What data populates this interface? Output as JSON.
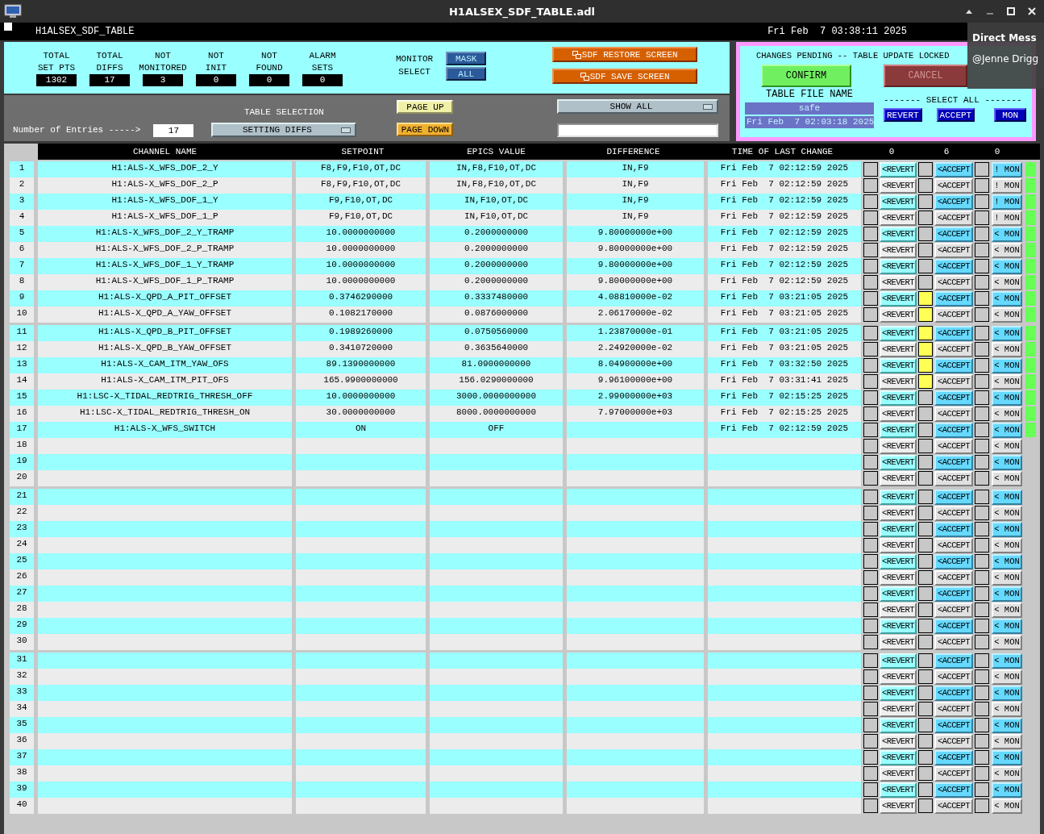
{
  "window": {
    "title": "H1ALSEX_SDF_TABLE.adl"
  },
  "header": {
    "name": "H1ALSEX_SDF_TABLE",
    "datetime": "Fri Feb  7 03:38:11 2025"
  },
  "stats": [
    {
      "label": "TOTAL\nSET PTS",
      "value": "1302"
    },
    {
      "label": "TOTAL\nDIFFS",
      "value": "17"
    },
    {
      "label": "NOT\nMONITORED",
      "value": "3"
    },
    {
      "label": "NOT\nINIT",
      "value": "0"
    },
    {
      "label": "NOT\nFOUND",
      "value": "0"
    },
    {
      "label": "ALARM\nSETS",
      "value": "0"
    }
  ],
  "monitor_select": {
    "label": "MONITOR\nSELECT",
    "buttons": [
      "MASK",
      "ALL"
    ]
  },
  "sdf_buttons": [
    "SDF RESTORE SCREEN",
    "SDF SAVE SCREEN"
  ],
  "table_selection": {
    "label": "TABLE SELECTION",
    "entries_label": "Number of Entries ----->",
    "entries": "17",
    "dropdown": "SETTING DIFFS",
    "page_up": "PAGE UP",
    "page_down": "PAGE DOWN",
    "show_dropdown": "SHOW ALL"
  },
  "pending": {
    "message": "CHANGES PENDING -- TABLE UPDATE LOCKED",
    "confirm": "CONFIRM",
    "cancel": "CANCEL",
    "file_label": "TABLE FILE NAME",
    "file_name": "safe",
    "file_time": "Fri Feb  7 02:03:18 2025",
    "select_all": "------- SELECT ALL -------",
    "select_buttons": [
      "REVERT",
      "ACCEPT",
      "MON"
    ]
  },
  "notification": {
    "title": "Direct Mess",
    "sender": "@Jenne Drigg"
  },
  "table": {
    "columns": [
      "CHANNEL NAME",
      "SETPOINT",
      "EPICS VALUE",
      "DIFFERENCE",
      "TIME OF LAST CHANGE"
    ],
    "counts": [
      "0",
      "6",
      "0"
    ],
    "rows": [
      {
        "n": "1",
        "channel": "H1:ALS-X_WFS_DOF_2_Y",
        "setpoint": "F8,F9,F10,OT,DC",
        "epics": "IN,F8,F10,OT,DC",
        "diff": "IN,F9",
        "time": "Fri Feb  7 02:12:59 2025",
        "revert": "<REVERT",
        "accept": "<ACCEPT",
        "mon": "! MON",
        "revert_selected": false,
        "accept_selected": false,
        "mon_selected": false,
        "in_sync": true
      },
      {
        "n": "2",
        "channel": "H1:ALS-X_WFS_DOF_2_P",
        "setpoint": "F8,F9,F10,OT,DC",
        "epics": "IN,F8,F10,OT,DC",
        "diff": "IN,F9",
        "time": "Fri Feb  7 02:12:59 2025",
        "revert": "<REVERT",
        "accept": "<ACCEPT",
        "mon": "! MON",
        "revert_selected": false,
        "accept_selected": false,
        "mon_selected": false,
        "in_sync": true
      },
      {
        "n": "3",
        "channel": "H1:ALS-X_WFS_DOF_1_Y",
        "setpoint": "F9,F10,OT,DC",
        "epics": "IN,F10,OT,DC",
        "diff": "IN,F9",
        "time": "Fri Feb  7 02:12:59 2025",
        "revert": "<REVERT",
        "accept": "<ACCEPT",
        "mon": "! MON",
        "revert_selected": false,
        "accept_selected": false,
        "mon_selected": false,
        "in_sync": true
      },
      {
        "n": "4",
        "channel": "H1:ALS-X_WFS_DOF_1_P",
        "setpoint": "F9,F10,OT,DC",
        "epics": "IN,F10,OT,DC",
        "diff": "IN,F9",
        "time": "Fri Feb  7 02:12:59 2025",
        "revert": "<REVERT",
        "accept": "<ACCEPT",
        "mon": "! MON",
        "revert_selected": false,
        "accept_selected": false,
        "mon_selected": false,
        "in_sync": true
      },
      {
        "n": "5",
        "channel": "H1:ALS-X_WFS_DOF_2_Y_TRAMP",
        "setpoint": "10.0000000000",
        "epics": "0.2000000000",
        "diff": "9.80000000e+00",
        "time": "Fri Feb  7 02:12:59 2025",
        "revert": "<REVERT",
        "accept": "<ACCEPT",
        "mon": "< MON",
        "revert_selected": false,
        "accept_selected": false,
        "mon_selected": false,
        "in_sync": true
      },
      {
        "n": "6",
        "channel": "H1:ALS-X_WFS_DOF_2_P_TRAMP",
        "setpoint": "10.0000000000",
        "epics": "0.2000000000",
        "diff": "9.80000000e+00",
        "time": "Fri Feb  7 02:12:59 2025",
        "revert": "<REVERT",
        "accept": "<ACCEPT",
        "mon": "< MON",
        "revert_selected": false,
        "accept_selected": false,
        "mon_selected": false,
        "in_sync": true
      },
      {
        "n": "7",
        "channel": "H1:ALS-X_WFS_DOF_1_Y_TRAMP",
        "setpoint": "10.0000000000",
        "epics": "0.2000000000",
        "diff": "9.80000000e+00",
        "time": "Fri Feb  7 02:12:59 2025",
        "revert": "<REVERT",
        "accept": "<ACCEPT",
        "mon": "< MON",
        "revert_selected": false,
        "accept_selected": false,
        "mon_selected": false,
        "in_sync": true
      },
      {
        "n": "8",
        "channel": "H1:ALS-X_WFS_DOF_1_P_TRAMP",
        "setpoint": "10.0000000000",
        "epics": "0.2000000000",
        "diff": "9.80000000e+00",
        "time": "Fri Feb  7 02:12:59 2025",
        "revert": "<REVERT",
        "accept": "<ACCEPT",
        "mon": "< MON",
        "revert_selected": false,
        "accept_selected": false,
        "mon_selected": false,
        "in_sync": true
      },
      {
        "n": "9",
        "channel": "H1:ALS-X_QPD_A_PIT_OFFSET",
        "setpoint": "0.3746290000",
        "epics": "0.3337480000",
        "diff": "4.08810000e-02",
        "time": "Fri Feb  7 03:21:05 2025",
        "revert": "<REVERT",
        "accept": "<ACCEPT",
        "mon": "< MON",
        "revert_selected": false,
        "accept_selected": true,
        "mon_selected": false,
        "in_sync": true
      },
      {
        "n": "10",
        "channel": "H1:ALS-X_QPD_A_YAW_OFFSET",
        "setpoint": "0.1082170000",
        "epics": "0.0876000000",
        "diff": "2.06170000e-02",
        "time": "Fri Feb  7 03:21:05 2025",
        "revert": "<REVERT",
        "accept": "<ACCEPT",
        "mon": "< MON",
        "revert_selected": false,
        "accept_selected": true,
        "mon_selected": false,
        "in_sync": true
      },
      {
        "n": "11",
        "channel": "H1:ALS-X_QPD_B_PIT_OFFSET",
        "setpoint": "0.1989260000",
        "epics": "0.0750560000",
        "diff": "1.23870000e-01",
        "time": "Fri Feb  7 03:21:05 2025",
        "revert": "<REVERT",
        "accept": "<ACCEPT",
        "mon": "< MON",
        "revert_selected": false,
        "accept_selected": true,
        "mon_selected": false,
        "in_sync": true
      },
      {
        "n": "12",
        "channel": "H1:ALS-X_QPD_B_YAW_OFFSET",
        "setpoint": "0.3410720000",
        "epics": "0.3635640000",
        "diff": "2.24920000e-02",
        "time": "Fri Feb  7 03:21:05 2025",
        "revert": "<REVERT",
        "accept": "<ACCEPT",
        "mon": "< MON",
        "revert_selected": false,
        "accept_selected": true,
        "mon_selected": false,
        "in_sync": true
      },
      {
        "n": "13",
        "channel": "H1:ALS-X_CAM_ITM_YAW_OFS",
        "setpoint": "89.1390000000",
        "epics": "81.0900000000",
        "diff": "8.04900000e+00",
        "time": "Fri Feb  7 03:32:50 2025",
        "revert": "<REVERT",
        "accept": "<ACCEPT",
        "mon": "< MON",
        "revert_selected": false,
        "accept_selected": true,
        "mon_selected": false,
        "in_sync": true
      },
      {
        "n": "14",
        "channel": "H1:ALS-X_CAM_ITM_PIT_OFS",
        "setpoint": "165.9900000000",
        "epics": "156.0290000000",
        "diff": "9.96100000e+00",
        "time": "Fri Feb  7 03:31:41 2025",
        "revert": "<REVERT",
        "accept": "<ACCEPT",
        "mon": "< MON",
        "revert_selected": false,
        "accept_selected": true,
        "mon_selected": false,
        "in_sync": true
      },
      {
        "n": "15",
        "channel": "H1:LSC-X_TIDAL_REDTRIG_THRESH_OFF",
        "setpoint": "10.0000000000",
        "epics": "3000.0000000000",
        "diff": "2.99000000e+03",
        "time": "Fri Feb  7 02:15:25 2025",
        "revert": "<REVERT",
        "accept": "<ACCEPT",
        "mon": "< MON",
        "revert_selected": false,
        "accept_selected": false,
        "mon_selected": false,
        "in_sync": true
      },
      {
        "n": "16",
        "channel": "H1:LSC-X_TIDAL_REDTRIG_THRESH_ON",
        "setpoint": "30.0000000000",
        "epics": "8000.0000000000",
        "diff": "7.97000000e+03",
        "time": "Fri Feb  7 02:15:25 2025",
        "revert": "<REVERT",
        "accept": "<ACCEPT",
        "mon": "< MON",
        "revert_selected": false,
        "accept_selected": false,
        "mon_selected": false,
        "in_sync": true
      },
      {
        "n": "17",
        "channel": "H1:ALS-X_WFS_SWITCH",
        "setpoint": "ON",
        "epics": "OFF",
        "time": "Fri Feb  7 02:12:59 2025",
        "revert": "<REVERT",
        "accept": "<ACCEPT",
        "mon": "< MON",
        "revert_selected": false,
        "accept_selected": false,
        "mon_selected": false,
        "in_sync": true
      },
      {
        "n": "18",
        "revert": "<REVERT",
        "accept": "<ACCEPT",
        "mon": "< MON",
        "revert_selected": false,
        "accept_selected": false,
        "mon_selected": false,
        "in_sync": false
      },
      {
        "n": "19",
        "revert": "<REVERT",
        "accept": "<ACCEPT",
        "mon": "< MON",
        "revert_selected": false,
        "accept_selected": false,
        "mon_selected": false,
        "in_sync": false
      },
      {
        "n": "20",
        "revert": "<REVERT",
        "accept": "<ACCEPT",
        "mon": "< MON",
        "revert_selected": false,
        "accept_selected": false,
        "mon_selected": false,
        "in_sync": false
      },
      {
        "n": "21",
        "revert": "<REVERT",
        "accept": "<ACCEPT",
        "mon": "< MON",
        "revert_selected": false,
        "accept_selected": false,
        "mon_selected": false,
        "in_sync": false
      },
      {
        "n": "22",
        "revert": "<REVERT",
        "accept": "<ACCEPT",
        "mon": "< MON",
        "revert_selected": false,
        "accept_selected": false,
        "mon_selected": false,
        "in_sync": false
      },
      {
        "n": "23",
        "revert": "<REVERT",
        "accept": "<ACCEPT",
        "mon": "< MON",
        "revert_selected": false,
        "accept_selected": false,
        "mon_selected": false,
        "in_sync": false
      },
      {
        "n": "24",
        "revert": "<REVERT",
        "accept": "<ACCEPT",
        "mon": "< MON",
        "revert_selected": false,
        "accept_selected": false,
        "mon_selected": false,
        "in_sync": false
      },
      {
        "n": "25",
        "revert": "<REVERT",
        "accept": "<ACCEPT",
        "mon": "< MON",
        "revert_selected": false,
        "accept_selected": false,
        "mon_selected": false,
        "in_sync": false
      },
      {
        "n": "26",
        "revert": "<REVERT",
        "accept": "<ACCEPT",
        "mon": "< MON",
        "revert_selected": false,
        "accept_selected": false,
        "mon_selected": false,
        "in_sync": false
      },
      {
        "n": "27",
        "revert": "<REVERT",
        "accept": "<ACCEPT",
        "mon": "< MON",
        "revert_selected": false,
        "accept_selected": false,
        "mon_selected": false,
        "in_sync": false
      },
      {
        "n": "28",
        "revert": "<REVERT",
        "accept": "<ACCEPT",
        "mon": "< MON",
        "revert_selected": false,
        "accept_selected": false,
        "mon_selected": false,
        "in_sync": false
      },
      {
        "n": "29",
        "revert": "<REVERT",
        "accept": "<ACCEPT",
        "mon": "< MON",
        "revert_selected": false,
        "accept_selected": false,
        "mon_selected": false,
        "in_sync": false
      },
      {
        "n": "30",
        "revert": "<REVERT",
        "accept": "<ACCEPT",
        "mon": "< MON",
        "revert_selected": false,
        "accept_selected": false,
        "mon_selected": false,
        "in_sync": false
      },
      {
        "n": "31",
        "revert": "<REVERT",
        "accept": "<ACCEPT",
        "mon": "< MON",
        "revert_selected": false,
        "accept_selected": false,
        "mon_selected": false,
        "in_sync": false
      },
      {
        "n": "32",
        "revert": "<REVERT",
        "accept": "<ACCEPT",
        "mon": "< MON",
        "revert_selected": false,
        "accept_selected": false,
        "mon_selected": false,
        "in_sync": false
      },
      {
        "n": "33",
        "revert": "<REVERT",
        "accept": "<ACCEPT",
        "mon": "< MON",
        "revert_selected": false,
        "accept_selected": false,
        "mon_selected": false,
        "in_sync": false
      },
      {
        "n": "34",
        "revert": "<REVERT",
        "accept": "<ACCEPT",
        "mon": "< MON",
        "revert_selected": false,
        "accept_selected": false,
        "mon_selected": false,
        "in_sync": false
      },
      {
        "n": "35",
        "revert": "<REVERT",
        "accept": "<ACCEPT",
        "mon": "< MON",
        "revert_selected": false,
        "accept_selected": false,
        "mon_selected": false,
        "in_sync": false
      },
      {
        "n": "36",
        "revert": "<REVERT",
        "accept": "<ACCEPT",
        "mon": "< MON",
        "revert_selected": false,
        "accept_selected": false,
        "mon_selected": false,
        "in_sync": false
      },
      {
        "n": "37",
        "revert": "<REVERT",
        "accept": "<ACCEPT",
        "mon": "< MON",
        "revert_selected": false,
        "accept_selected": false,
        "mon_selected": false,
        "in_sync": false
      },
      {
        "n": "38",
        "revert": "<REVERT",
        "accept": "<ACCEPT",
        "mon": "< MON",
        "revert_selected": false,
        "accept_selected": false,
        "mon_selected": false,
        "in_sync": false
      },
      {
        "n": "39",
        "revert": "<REVERT",
        "accept": "<ACCEPT",
        "mon": "< MON",
        "revert_selected": false,
        "accept_selected": false,
        "mon_selected": false,
        "in_sync": false
      },
      {
        "n": "40",
        "revert": "<REVERT",
        "accept": "<ACCEPT",
        "mon": "< MON",
        "revert_selected": false,
        "accept_selected": false,
        "mon_selected": false,
        "in_sync": false
      }
    ]
  }
}
